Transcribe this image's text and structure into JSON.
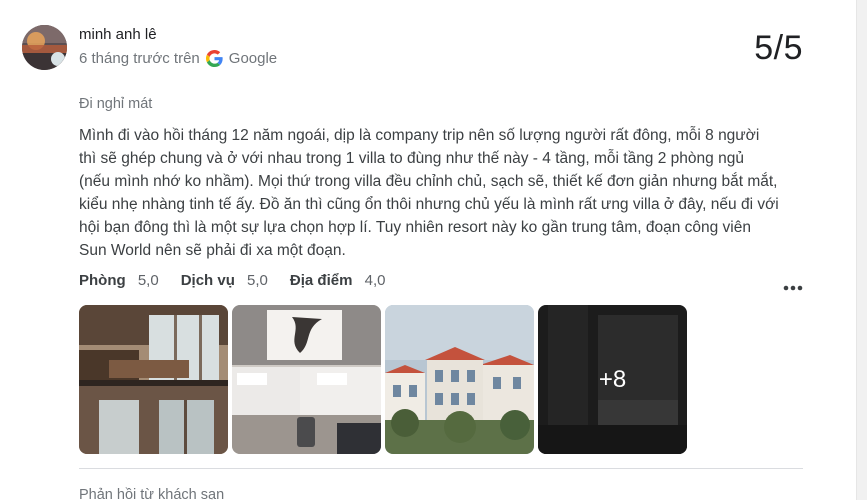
{
  "review": {
    "author": "minh anh lê",
    "time": "6 tháng trước trên",
    "source": "Google",
    "score": "5/5",
    "trip_type": "Đi nghỉ mát",
    "text": "Mình đi vào hồi tháng 12 năm ngoái, dịp là company trip nên số lượng người rất đông, mỗi 8 người thì sẽ ghép chung và ở với nhau trong 1 villa to đùng như thế này - 4 tầng, mỗi tầng 2 phòng ngủ (nếu mình nhớ ko nhầm). Mọi thứ trong villa đều chỉnh chủ, sạch sẽ, thiết kế đơn giản nhưng bắt mắt, kiểu nhẹ nhàng tinh tế ấy. Đồ ăn thì cũng ổn thôi nhưng chủ yếu là mình rất ưng villa ở đây, nếu đi với hội bạn đông thì là một sự lựa chọn hợp lí. Tuy nhiên resort này ko gần trung tâm, đoạn công viên Sun World nên sẽ phải đi xa một đoạn.",
    "subratings": [
      {
        "label": "Phòng",
        "value": "5,0"
      },
      {
        "label": "Dịch vụ",
        "value": "5,0"
      },
      {
        "label": "Địa điểm",
        "value": "4,0"
      }
    ],
    "photos_more_label": "+8",
    "owner_response_label": "Phản hồi từ khách sạn"
  },
  "icons": {
    "google": "google-g-icon",
    "more": "more-horizontal-icon"
  },
  "colors": {
    "secondary_text": "#70757a",
    "body_text": "#3c4043",
    "divider": "#dadce0"
  }
}
